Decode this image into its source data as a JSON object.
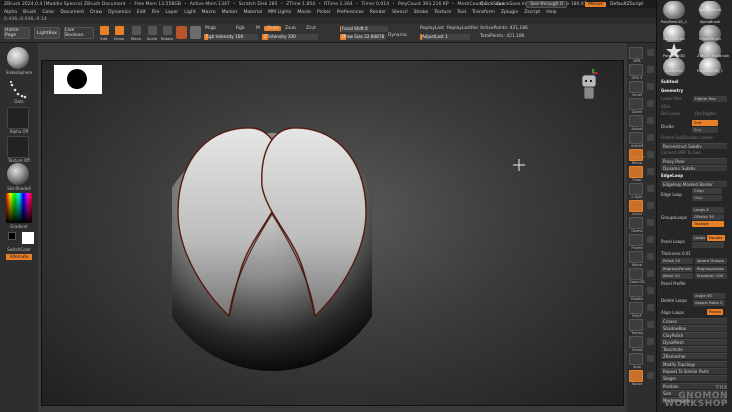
{
  "title_bar": {
    "items": [
      "ZBrush 2024.0.4 [Maddie Spence] ZBrush Document",
      "Free Mem 13.558GB",
      "Active Mem 1347",
      "Scratch Disk 285",
      "ZTime 1.854",
      "RTime 1.364",
      "Timer 0.014",
      "PolyCount 393.216 KP",
      "MeshCount 1",
      "QuickSave In 11 Secs",
      "Mouse 180,97 mm"
    ],
    "right": {
      "quicksave": "QuickSave",
      "see_through": "See-through 0",
      "menus": "Menus",
      "default_zscript": "DefaultZScript"
    }
  },
  "menu_bar": {
    "items": [
      "Alpha",
      "Brush",
      "Color",
      "Document",
      "Draw",
      "Dynamics",
      "Edit",
      "File",
      "Layer",
      "Light",
      "Macro",
      "Marker",
      "Material",
      "MM Lights",
      "Movie",
      "Picker",
      "Preferences",
      "Render",
      "Stencil",
      "Stroke",
      "Texture",
      "Tool",
      "Transform",
      "Zplugin",
      "Zscript",
      "Help"
    ]
  },
  "coords": "0.436,-0.036,-0.14",
  "toolbar": {
    "home_page": "Home Page",
    "lightbox": "LightBox",
    "live_boolean": "Live Boolean",
    "tools": [
      {
        "label": "Edit",
        "active": true
      },
      {
        "label": "Draw",
        "active": true
      },
      {
        "label": "Move",
        "active": false
      },
      {
        "label": "Scale",
        "active": false
      },
      {
        "label": "Rotate",
        "active": false
      }
    ],
    "mrgb": "Mrgb",
    "rgb": "Rgb",
    "m": "M",
    "zadd": "Zadd",
    "zsub": "Zsub",
    "zcut": "Zcut",
    "rgb_intensity": "Rgb Intensity 100",
    "z_intensity": "Z Intensity 100",
    "focal_shift": "Focal Shift 0",
    "draw_size": "Draw Size 22.84878",
    "dynamic": "Dynamic",
    "replay_last": "ReplayLast",
    "replay_last_rel": "ReplayLastRel",
    "active_points": "ActivePoints: 421,186",
    "adjust_last": "AdjustLast 1",
    "total_points": "TotalPoints: 421,186"
  },
  "left_shelf": {
    "items": [
      "SnakeSphere",
      "Dots",
      "Alpha Off",
      "Texture Off",
      "SkinShade4",
      "Gradient",
      "SwitchColor",
      "Alternate"
    ]
  },
  "right_shelf": {
    "items": [
      "BPR",
      "SPix 3",
      "Scroll",
      "Zoom",
      "Actual",
      "AAHalf",
      "Persp",
      "Floor",
      "L.Sym",
      "Local",
      "Gizmo",
      "Frame",
      "Move",
      "Zoom3D",
      "Rotate",
      "PolyF",
      "Transp",
      "Ghost",
      "Solo",
      "Xpose"
    ],
    "dynamic_label": "Dynamic"
  },
  "right_panel": {
    "thumbs": [
      {
        "label": "PolyMesh3D_1"
      },
      {
        "label": "SphereBrush"
      },
      {
        "label": "AlphaBrush"
      },
      {
        "label": "SimpleBrush"
      },
      {
        "label": "EraserBrush"
      },
      {
        "label": "PolyMesh3D"
      },
      {
        "label": "ZBrush_FastBrush"
      },
      {
        "label": "Sphere3D"
      },
      {
        "label": "PolyMesh3D_1"
      }
    ],
    "subtool": "Subtool",
    "geometry": "Geometry",
    "lower_res": "Lower Res",
    "higher_res": "Higher Res",
    "sdiv": "SDiv",
    "del_lower": "Del Lower",
    "del_higher": "Del Higher",
    "divide": "Divide",
    "smt": "Smt",
    "suv": "Suv",
    "freeze_subdivision_levels": "Freeze SubDivision Levels",
    "reconstruct_subdiv": "Reconstruct Subdiv",
    "convert_bpr_to_geo": "Convert BPR To Geo",
    "proxy_pose": "Proxy Pose",
    "dynamic_subdiv": "Dynamic Subdiv",
    "edgeloop": "EdgeLoop",
    "edgeloop_masked_border": "Edgeloop Masked Border",
    "edge_loop": "Edge Loop",
    "crisp": "Crisp",
    "disp": "Disp",
    "groups_loops": "GroupsLoops",
    "loops": "Loops 4",
    "gpolish": "GPolish 50",
    "triangle": "Triangle",
    "panel_loops": "Panel Loops",
    "loops2": "Loops",
    "double": "Double",
    "thickness": "Thickness 0.01",
    "polish": "Polish 10",
    "ignore_groups": "Ignore Groups",
    "regroup_panels": "RegroupPanels",
    "regroup_loops": "RegroupLoops",
    "bevel": "Bevel 20",
    "elevation": "Elevation 100",
    "panel_profile": "Panel Profile",
    "delete_loops": "Delete Loops",
    "angle": "Angle 45",
    "aspect_ratio": "Aspect Ratio 2",
    "align_loops": "Align Loops",
    "partial": "Partial",
    "crease": "Crease",
    "shadowbox": "ShadowBox",
    "claypolish": "ClayPolish",
    "dynamesh": "DynaMesh",
    "tessimate": "Tessimate",
    "zremesher": "ZRemesher",
    "modify_topology": "Modify Topology",
    "repeat_to_similar_parts": "Repeat To Similar Parts",
    "stager": "Stager",
    "position": "Position",
    "size": "Size",
    "meshintegrity": "MeshIntegrity"
  },
  "watermark": {
    "line1": "THE",
    "line2": "GNOMON",
    "line3": "WORKSHOP"
  },
  "colors": {
    "accent": "#e8802a",
    "panel": "#2e2e2e",
    "canvas": "#3c3c3c"
  },
  "icons": [
    "nav-cube-icon",
    "color-picker-icon",
    "alpha-square-icon",
    "brush-sphere-icon",
    "dots-stroke-icon"
  ]
}
